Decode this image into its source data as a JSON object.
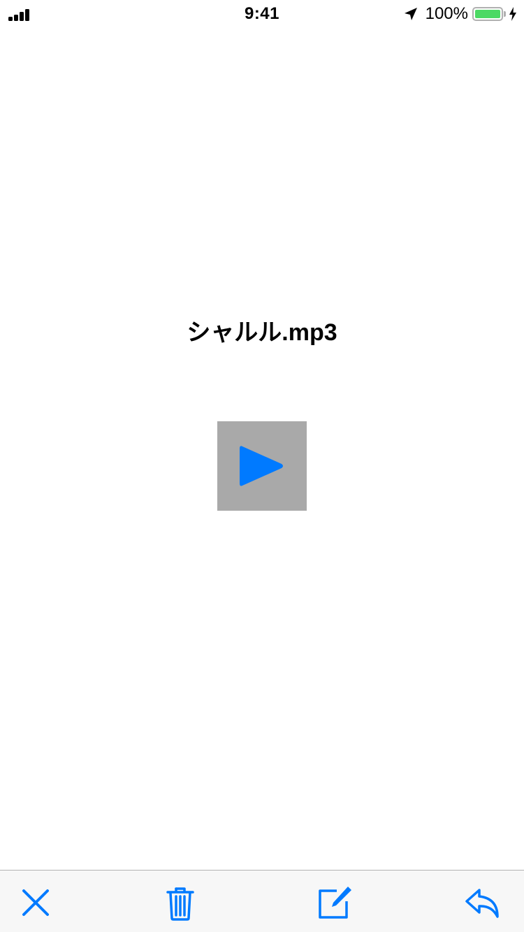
{
  "status_bar": {
    "time": "9:41",
    "battery_percent": "100%",
    "battery_level": 1.0,
    "signal_bars": 4,
    "icons": [
      "signal-icon",
      "location-arrow-icon",
      "battery-icon",
      "charging-bolt-icon"
    ]
  },
  "main": {
    "file_name": "シャルル.mp3",
    "play_icon": "play-icon"
  },
  "toolbar": {
    "items": [
      {
        "icon": "close-icon"
      },
      {
        "icon": "trash-icon"
      },
      {
        "icon": "compose-icon"
      },
      {
        "icon": "reply-icon"
      }
    ]
  },
  "colors": {
    "accent": "#007aff",
    "play_background": "#a9a9a9",
    "battery_fill": "#4cd964",
    "toolbar_background": "#f7f7f7"
  }
}
